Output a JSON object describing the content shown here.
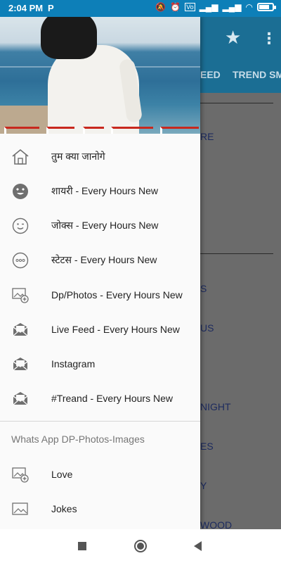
{
  "status_bar": {
    "time": "2:04 PM",
    "badge": "P",
    "icons": [
      "mute-icon",
      "alarm-icon",
      "volte-icon",
      "signal-icon",
      "signal-icon",
      "wifi-icon",
      "battery-icon"
    ],
    "battery_level": 0.75
  },
  "app": {
    "tabs": [
      "EED",
      "TREND SM"
    ],
    "content_items": [
      "RE",
      "S",
      "US",
      "NIGHT",
      "ES",
      "Y",
      "WOOD"
    ]
  },
  "drawer": {
    "items": [
      {
        "label": "तुम क्या जानोगे",
        "icon": "home-icon"
      },
      {
        "label": "शायरी - Every Hours New",
        "icon": "love-face-icon"
      },
      {
        "label": "जोक्स - Every Hours New",
        "icon": "wink-face-icon"
      },
      {
        "label": "स्टेटस - Every Hours New",
        "icon": "dots-circle-icon"
      },
      {
        "label": "Dp/Photos - Every Hours New",
        "icon": "photo-add-icon"
      },
      {
        "label": "Live Feed - Every Hours New",
        "icon": "mail-envelope-icon"
      },
      {
        "label": "Instagram",
        "icon": "mail-envelope-icon"
      },
      {
        "label": "#Treand - Every Hours New",
        "icon": "mail-envelope-icon"
      }
    ],
    "section_title": "Whats App DP-Photos-Images",
    "section_items": [
      {
        "label": "Love",
        "icon": "photo-add-icon"
      },
      {
        "label": "Jokes",
        "icon": "image-icon"
      }
    ]
  },
  "colors": {
    "statusbar": "#0d7fb8",
    "appbar": "#1b6e94",
    "drawer_bg": "#fafafa",
    "icon_gray": "#6f6f6f"
  }
}
